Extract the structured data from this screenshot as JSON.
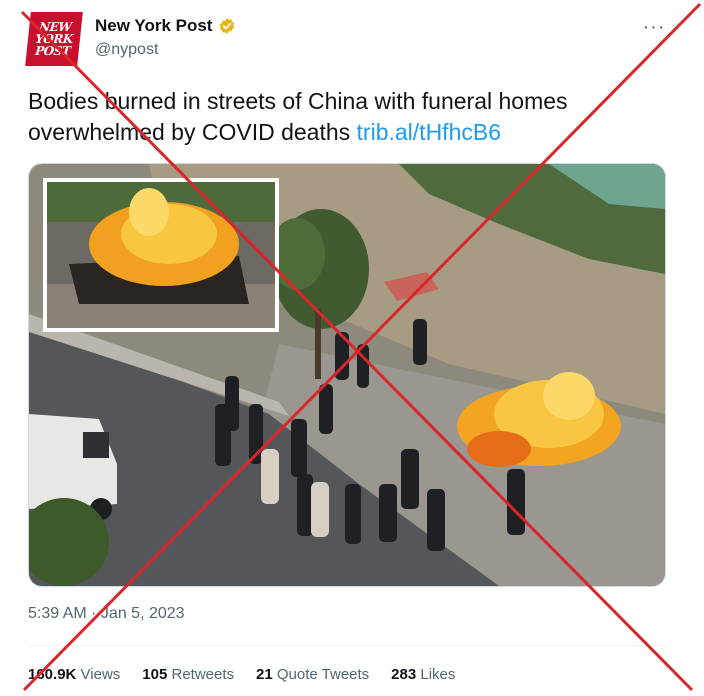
{
  "tweet": {
    "display_name": "New York Post",
    "handle": "@nypost",
    "avatar_lines": [
      "NEW",
      "YORK",
      "POST"
    ],
    "more_label": "···",
    "text_line1": "Bodies burned in streets of China with funeral homes",
    "text_line2": "overwhelmed by COVID deaths ",
    "link": "trib.al/tHfhcB6",
    "timestamp": "5:39 AM · Jan 5, 2023"
  },
  "stats": {
    "views_count": "160.9K",
    "views_label": "Views",
    "retweets_count": "105",
    "retweets_label": "Retweets",
    "quotes_count": "21",
    "quotes_label": "Quote Tweets",
    "likes_count": "283",
    "likes_label": "Likes"
  },
  "colors": {
    "brand_red": "#c8102e",
    "link_blue": "#1d9bf0",
    "verified_gold": "#e2b719",
    "overlay_red": "#d9262b"
  },
  "icons": {
    "verified": "verified-badge-icon",
    "more": "more-options-icon"
  }
}
